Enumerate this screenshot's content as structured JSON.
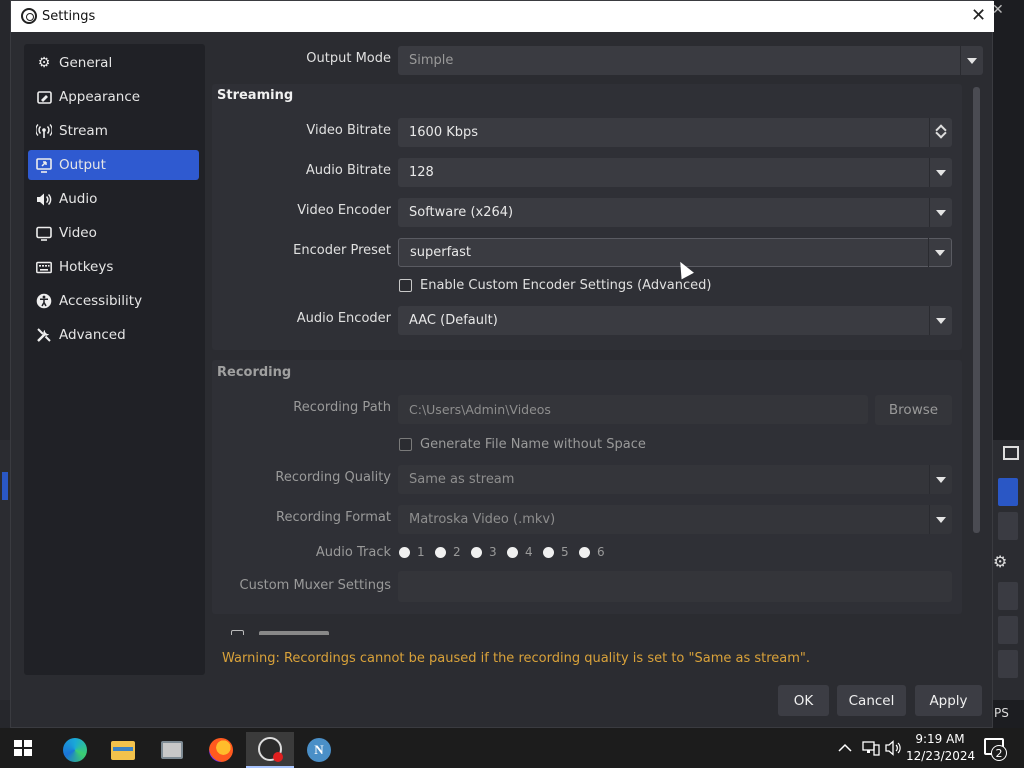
{
  "window": {
    "title": "Settings"
  },
  "sidebar": {
    "items": [
      {
        "label": "General",
        "icon": "gear-icon",
        "active": false
      },
      {
        "label": "Appearance",
        "icon": "appearance-icon",
        "active": false
      },
      {
        "label": "Stream",
        "icon": "antenna-icon",
        "active": false
      },
      {
        "label": "Output",
        "icon": "output-icon",
        "active": true
      },
      {
        "label": "Audio",
        "icon": "speaker-icon",
        "active": false
      },
      {
        "label": "Video",
        "icon": "monitor-icon",
        "active": false
      },
      {
        "label": "Hotkeys",
        "icon": "keyboard-icon",
        "active": false
      },
      {
        "label": "Accessibility",
        "icon": "accessibility-icon",
        "active": false
      },
      {
        "label": "Advanced",
        "icon": "tools-icon",
        "active": false
      }
    ]
  },
  "output_mode": {
    "label": "Output Mode",
    "value": "Simple"
  },
  "streaming": {
    "title": "Streaming",
    "video_bitrate": {
      "label": "Video Bitrate",
      "value": "1600 Kbps"
    },
    "audio_bitrate": {
      "label": "Audio Bitrate",
      "value": "128"
    },
    "video_encoder": {
      "label": "Video Encoder",
      "value": "Software (x264)"
    },
    "encoder_preset": {
      "label": "Encoder Preset",
      "value": "superfast"
    },
    "custom_encoder": {
      "label": "Enable Custom Encoder Settings (Advanced)",
      "checked": false
    },
    "audio_encoder": {
      "label": "Audio Encoder",
      "value": "AAC (Default)"
    }
  },
  "recording": {
    "title": "Recording",
    "path": {
      "label": "Recording Path",
      "value": "C:\\Users\\Admin\\Videos",
      "browse_label": "Browse"
    },
    "no_space": {
      "label": "Generate File Name without Space",
      "checked": false
    },
    "quality": {
      "label": "Recording Quality",
      "value": "Same as stream"
    },
    "format": {
      "label": "Recording Format",
      "value": "Matroska Video (.mkv)"
    },
    "audio_track": {
      "label": "Audio Track",
      "tracks": [
        "1",
        "2",
        "3",
        "4",
        "5",
        "6"
      ]
    },
    "muxer": {
      "label": "Custom Muxer Settings",
      "value": ""
    }
  },
  "warning": "Warning: Recordings cannot be paused if the recording quality is set to \"Same as stream\".",
  "buttons": {
    "ok": "OK",
    "cancel": "Cancel",
    "apply": "Apply"
  },
  "background": {
    "status_text": "PS"
  },
  "taskbar": {
    "apps": [
      "edge-icon",
      "file-explorer-icon",
      "disk-icon",
      "firefox-icon",
      "obs-icon",
      "app-n-icon"
    ],
    "time": "9:19 AM",
    "date": "12/23/2024",
    "notification_count": "2"
  },
  "colors": {
    "accent": "#2f5ad0",
    "warning": "#d9a23a",
    "dialog_bg": "#2b2c31"
  }
}
